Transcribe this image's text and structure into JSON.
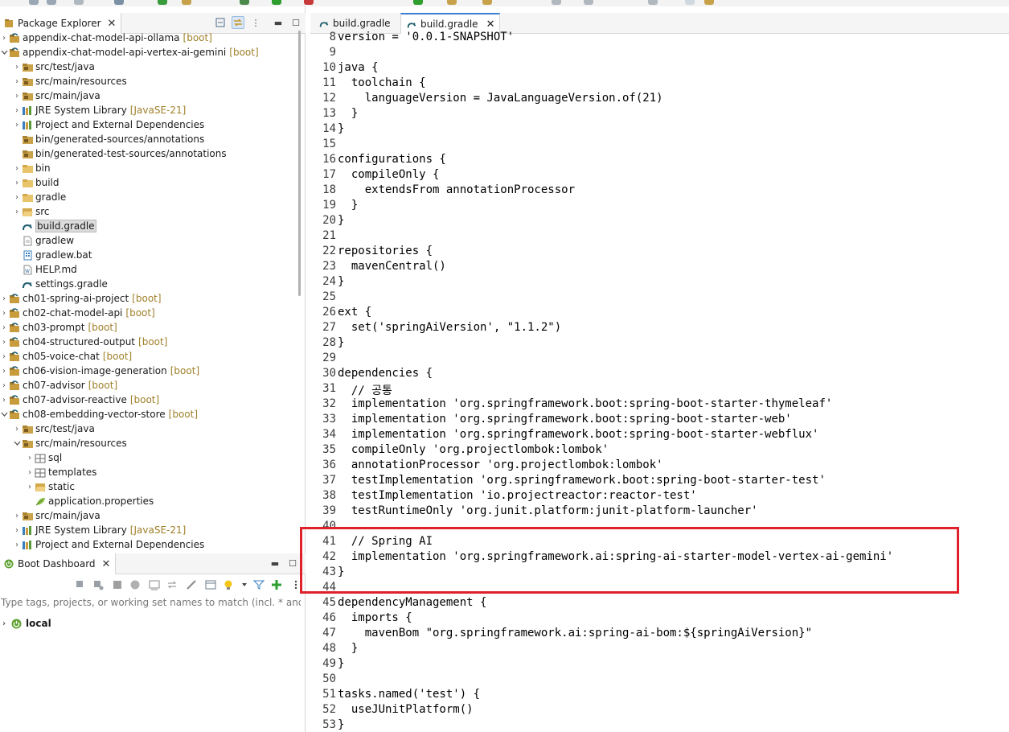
{
  "colors": {
    "highlight": "#e0202a",
    "deco": "#a0802a",
    "accent": "#3b7fd1"
  },
  "package_explorer": {
    "title": "Package Explorer",
    "items": [
      {
        "arrow": ">",
        "icon": "gradle-project-icon",
        "label": "appendix-chat-model-api-ollama",
        "deco": "[boot]",
        "indent": 0
      },
      {
        "arrow": "v",
        "icon": "gradle-project-icon",
        "label": "appendix-chat-model-api-vertex-ai-gemini",
        "deco": "[boot]",
        "indent": 0
      },
      {
        "arrow": ">",
        "icon": "source-folder-icon",
        "label": "src/test/java",
        "deco": "",
        "indent": 1
      },
      {
        "arrow": ">",
        "icon": "source-folder-icon",
        "label": "src/main/resources",
        "deco": "",
        "indent": 1
      },
      {
        "arrow": ">",
        "icon": "source-folder-icon",
        "label": "src/main/java",
        "deco": "",
        "indent": 1
      },
      {
        "arrow": ">",
        "icon": "library-icon",
        "label": "JRE System Library",
        "deco": "[JavaSE-21]",
        "indent": 1
      },
      {
        "arrow": ">",
        "icon": "library-icon",
        "label": "Project and External Dependencies",
        "deco": "",
        "indent": 1
      },
      {
        "arrow": "",
        "icon": "source-folder-icon",
        "label": "bin/generated-sources/annotations",
        "deco": "",
        "indent": 1
      },
      {
        "arrow": "",
        "icon": "source-folder-icon",
        "label": "bin/generated-test-sources/annotations",
        "deco": "",
        "indent": 1
      },
      {
        "arrow": ">",
        "icon": "folder-icon",
        "label": "bin",
        "deco": "",
        "indent": 1
      },
      {
        "arrow": ">",
        "icon": "folder-icon",
        "label": "build",
        "deco": "",
        "indent": 1
      },
      {
        "arrow": ">",
        "icon": "folder-icon",
        "label": "gradle",
        "deco": "",
        "indent": 1
      },
      {
        "arrow": ">",
        "icon": "folder-open-icon",
        "label": "src",
        "deco": "",
        "indent": 1
      },
      {
        "arrow": "",
        "icon": "gradle-file-icon",
        "label": "build.gradle",
        "deco": "",
        "indent": 1,
        "selected": true
      },
      {
        "arrow": "",
        "icon": "file-icon",
        "label": "gradlew",
        "deco": "",
        "indent": 1
      },
      {
        "arrow": "",
        "icon": "bat-file-icon",
        "label": "gradlew.bat",
        "deco": "",
        "indent": 1
      },
      {
        "arrow": "",
        "icon": "md-file-icon",
        "label": "HELP.md",
        "deco": "",
        "indent": 1
      },
      {
        "arrow": "",
        "icon": "gradle-file-icon",
        "label": "settings.gradle",
        "deco": "",
        "indent": 1
      },
      {
        "arrow": ">",
        "icon": "gradle-project-icon",
        "label": "ch01-spring-ai-project",
        "deco": "[boot]",
        "indent": 0
      },
      {
        "arrow": ">",
        "icon": "gradle-project-icon",
        "label": "ch02-chat-model-api",
        "deco": "[boot]",
        "indent": 0
      },
      {
        "arrow": ">",
        "icon": "gradle-project-icon",
        "label": "ch03-prompt",
        "deco": "[boot]",
        "indent": 0
      },
      {
        "arrow": ">",
        "icon": "gradle-project-icon",
        "label": "ch04-structured-output",
        "deco": "[boot]",
        "indent": 0
      },
      {
        "arrow": ">",
        "icon": "gradle-project-icon",
        "label": "ch05-voice-chat",
        "deco": "[boot]",
        "indent": 0
      },
      {
        "arrow": ">",
        "icon": "gradle-project-icon",
        "label": "ch06-vision-image-generation",
        "deco": "[boot]",
        "indent": 0
      },
      {
        "arrow": ">",
        "icon": "gradle-project-icon",
        "label": "ch07-advisor",
        "deco": "[boot]",
        "indent": 0
      },
      {
        "arrow": ">",
        "icon": "gradle-project-icon",
        "label": "ch07-advisor-reactive",
        "deco": "[boot]",
        "indent": 0
      },
      {
        "arrow": "v",
        "icon": "gradle-project-icon",
        "label": "ch08-embedding-vector-store",
        "deco": "[boot]",
        "indent": 0
      },
      {
        "arrow": ">",
        "icon": "source-folder-icon",
        "label": "src/test/java",
        "deco": "",
        "indent": 1
      },
      {
        "arrow": "v",
        "icon": "source-folder-icon",
        "label": "src/main/resources",
        "deco": "",
        "indent": 1
      },
      {
        "arrow": ">",
        "icon": "package-icon",
        "label": "sql",
        "deco": "",
        "indent": 2
      },
      {
        "arrow": ">",
        "icon": "package-icon",
        "label": "templates",
        "deco": "",
        "indent": 2
      },
      {
        "arrow": ">",
        "icon": "folder-open-icon",
        "label": "static",
        "deco": "",
        "indent": 2
      },
      {
        "arrow": "",
        "icon": "properties-file-icon",
        "label": "application.properties",
        "deco": "",
        "indent": 2
      },
      {
        "arrow": ">",
        "icon": "source-folder-icon",
        "label": "src/main/java",
        "deco": "",
        "indent": 1
      },
      {
        "arrow": ">",
        "icon": "library-icon",
        "label": "JRE System Library",
        "deco": "[JavaSE-21]",
        "indent": 1
      },
      {
        "arrow": ">",
        "icon": "library-icon",
        "label": "Project and External Dependencies",
        "deco": "",
        "indent": 1
      }
    ]
  },
  "boot_dashboard": {
    "title": "Boot Dashboard",
    "filter_placeholder": "Type tags, projects, or working set names to match (incl. * and ? wilc",
    "local_label": "local"
  },
  "editor": {
    "tabs": [
      {
        "label": "build.gradle",
        "active": false
      },
      {
        "label": "build.gradle",
        "active": true
      }
    ],
    "lines": [
      {
        "n": "8",
        "t": "version = '0.0.1-SNAPSHOT'"
      },
      {
        "n": "9",
        "t": ""
      },
      {
        "n": "10",
        "t": "java {"
      },
      {
        "n": "11",
        "t": "  toolchain {"
      },
      {
        "n": "12",
        "t": "    languageVersion = JavaLanguageVersion.of(21)"
      },
      {
        "n": "13",
        "t": "  }"
      },
      {
        "n": "14",
        "t": "}"
      },
      {
        "n": "15",
        "t": ""
      },
      {
        "n": "16",
        "t": "configurations {"
      },
      {
        "n": "17",
        "t": "  compileOnly {"
      },
      {
        "n": "18",
        "t": "    extendsFrom annotationProcessor"
      },
      {
        "n": "19",
        "t": "  }"
      },
      {
        "n": "20",
        "t": "}"
      },
      {
        "n": "21",
        "t": ""
      },
      {
        "n": "22",
        "t": "repositories {"
      },
      {
        "n": "23",
        "t": "  mavenCentral()"
      },
      {
        "n": "24",
        "t": "}"
      },
      {
        "n": "25",
        "t": ""
      },
      {
        "n": "26",
        "t": "ext {"
      },
      {
        "n": "27",
        "t": "  set('springAiVersion', \"1.1.2\")"
      },
      {
        "n": "28",
        "t": "}"
      },
      {
        "n": "29",
        "t": ""
      },
      {
        "n": "30",
        "t": "dependencies {"
      },
      {
        "n": "31",
        "t": "  // 공통"
      },
      {
        "n": "32",
        "t": "  implementation 'org.springframework.boot:spring-boot-starter-thymeleaf'"
      },
      {
        "n": "33",
        "t": "  implementation 'org.springframework.boot:spring-boot-starter-web'"
      },
      {
        "n": "34",
        "t": "  implementation 'org.springframework.boot:spring-boot-starter-webflux'"
      },
      {
        "n": "35",
        "t": "  compileOnly 'org.projectlombok:lombok'"
      },
      {
        "n": "36",
        "t": "  annotationProcessor 'org.projectlombok:lombok'"
      },
      {
        "n": "37",
        "t": "  testImplementation 'org.springframework.boot:spring-boot-starter-test'"
      },
      {
        "n": "38",
        "t": "  testImplementation 'io.projectreactor:reactor-test'"
      },
      {
        "n": "39",
        "t": "  testRuntimeOnly 'org.junit.platform:junit-platform-launcher'"
      },
      {
        "n": "40",
        "t": ""
      },
      {
        "n": "41",
        "t": "  // Spring AI"
      },
      {
        "n": "42",
        "t": "  implementation 'org.springframework.ai:spring-ai-starter-model-vertex-ai-gemini'"
      },
      {
        "n": "43",
        "t": "}"
      },
      {
        "n": "44",
        "t": ""
      },
      {
        "n": "45",
        "t": "dependencyManagement {"
      },
      {
        "n": "46",
        "t": "  imports {"
      },
      {
        "n": "47",
        "t": "    mavenBom \"org.springframework.ai:spring-ai-bom:${springAiVersion}\""
      },
      {
        "n": "48",
        "t": "  }"
      },
      {
        "n": "49",
        "t": "}"
      },
      {
        "n": "50",
        "t": ""
      },
      {
        "n": "51",
        "t": "tasks.named('test') {"
      },
      {
        "n": "52",
        "t": "  useJUnitPlatform()"
      },
      {
        "n": "53",
        "t": "}"
      }
    ]
  }
}
